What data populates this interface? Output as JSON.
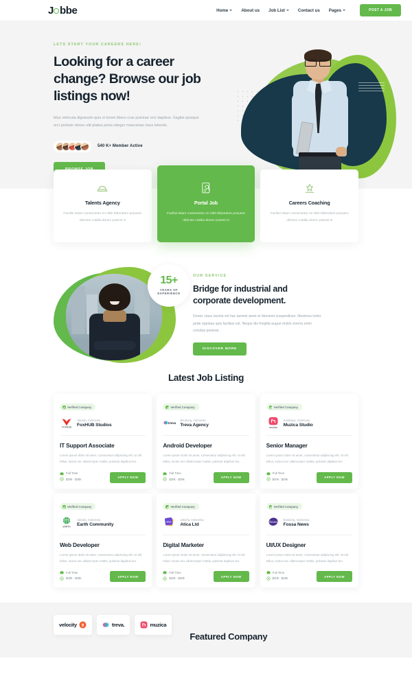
{
  "header": {
    "logo": {
      "before": "J",
      "ring": "o",
      "after": "bbe"
    },
    "nav": [
      {
        "label": "Home",
        "has_dropdown": true
      },
      {
        "label": "About us",
        "has_dropdown": false
      },
      {
        "label": "Job List",
        "has_dropdown": true
      },
      {
        "label": "Contact us",
        "has_dropdown": false
      },
      {
        "label": "Pages",
        "has_dropdown": true
      }
    ],
    "cta": "POST A JOB"
  },
  "hero": {
    "eyebrow": "LETS START YOUR CAREERS HERE!",
    "heading": "Looking for a career change? Browse our job listings now!",
    "paragraph": "Mus vehicula dignissim quis si lorem libero cras pulvinar orci dapibus. Sagitis quisque orci pretium donec elit platea porta integer maecenas risus lobortis.",
    "stat": "540 K+ Member Active",
    "cta": "BROWSE JOB"
  },
  "services": [
    {
      "icon": "helmet-icon",
      "title": "Talents Agency",
      "text": "Facilisi etiam consectetur mi nibh bibendum posuere ultricies cubilia donec potenti si",
      "active": false
    },
    {
      "icon": "document-search-icon",
      "title": "Portal Job",
      "text": "Facilisi etiam consectetur mi nibh bibendum posuere ultricies cubilia donec potenti si",
      "active": true
    },
    {
      "icon": "growth-icon",
      "title": "Careers Coaching",
      "text": "Facilisi etiam consectetur mi nibh bibendum posuere ultricies cubilia donec potenti si",
      "active": false
    }
  ],
  "about": {
    "badge_number": "15+",
    "badge_line1": "YEARS OF",
    "badge_line2": "EXPERIENCE",
    "eyebrow": "OUR SERVICE",
    "heading": "Bridge for industrial and corporate development.",
    "paragraph": "Donec class lacinia vel hac laoreet amet et dictumst suspendisse. Maximus tortor pede egestas quis facilisis est. Neque dis fringilla augue mollis viverra enim conubia pulvinar.",
    "cta": "DISCOVER MORE"
  },
  "jobs": {
    "title": "Latest Job Listing",
    "verified_label": "Verified Company",
    "items": [
      {
        "company": "FoxHUB Studios",
        "location": "Jakarta, Indonesia",
        "title": "IT Support Associate",
        "desc": "Lorem ipsum dolor sit amet, consectetur adipiscing elit. Ut elit tellus, luctus nec ullamcorper mattis, pulvinar dapibus leo.",
        "type": "Full Time",
        "salary": "$20k - $25k",
        "apply": "APPLY NOW",
        "logo": "fox-logo"
      },
      {
        "company": "Treva Agency",
        "location": "Bandung, Indonesia",
        "title": "Android Developer",
        "desc": "Lorem ipsum dolor sit amet, consectetur adipiscing elit. Ut elit tellus, luctus nec ullamcorper mattis, pulvinar dapibus leo.",
        "type": "Full Time",
        "salary": "$20k - $25k",
        "apply": "APPLY NOW",
        "logo": "treva-logo"
      },
      {
        "company": "Muzica Studio",
        "location": "Surabaya, Indonesia",
        "title": "Senior Manager",
        "desc": "Lorem ipsum dolor sit amet, consectetur adipiscing elit. Ut elit tellus, luctus nec ullamcorper mattis, pulvinar dapibus leo.",
        "type": "Full Time",
        "salary": "$20k - $25k",
        "apply": "APPLY NOW",
        "logo": "muzica-logo"
      },
      {
        "company": "Earth Community",
        "location": "Jakarta, Indonesia",
        "title": "Web Developer",
        "desc": "Lorem ipsum dolor sit amet, consectetur adipiscing elit. Ut elit tellus, luctus nec ullamcorper mattis, pulvinar dapibus leo.",
        "type": "Full Time",
        "salary": "$20k - $25k",
        "apply": "APPLY NOW",
        "logo": "earth-logo"
      },
      {
        "company": "Atica Ltd",
        "location": "Jakarta, Indonesia",
        "title": "Digital Marketer",
        "desc": "Lorem ipsum dolor sit amet, consectetur adipiscing elit. Ut elit tellus, luctus nec ullamcorper mattis, pulvinar dapibus leo.",
        "type": "Full Time",
        "salary": "$20k - $25k",
        "apply": "APPLY NOW",
        "logo": "atica-logo"
      },
      {
        "company": "Fossa News",
        "location": "Bandung, Indonesia",
        "title": "UI/UX Designer",
        "desc": "Lorem ipsum dolor sit amet, consectetur adipiscing elit. Ut elit tellus, luctus nec ullamcorper mattis, pulvinar dapibus leo.",
        "type": "Full Time",
        "salary": "$20k - $25k",
        "apply": "APPLY NOW",
        "logo": "fossa-logo"
      }
    ]
  },
  "featured": {
    "title": "Featured Company",
    "brands": [
      {
        "name": "velocity",
        "mark": "9"
      },
      {
        "name": "treva.",
        "mark": ""
      },
      {
        "name": "muzica",
        "mark": "M"
      }
    ]
  },
  "colors": {
    "green": "#63b94b",
    "green_light": "#8cc63f",
    "navy": "#17394a",
    "dark": "#16232e",
    "muted": "#a6aeb4",
    "band": "#f4f4f4"
  }
}
